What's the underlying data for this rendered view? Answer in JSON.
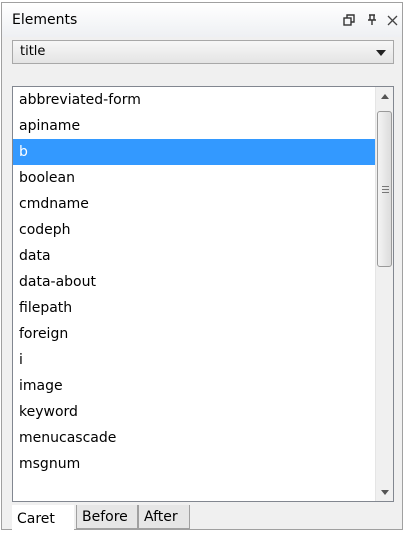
{
  "panel": {
    "title": "Elements",
    "icons": [
      "restore-icon",
      "pin-icon",
      "close-icon"
    ]
  },
  "combo": {
    "value": "title"
  },
  "list": {
    "selected_index": 2,
    "items": [
      "abbreviated-form",
      "apiname",
      "b",
      "boolean",
      "cmdname",
      "codeph",
      "data",
      "data-about",
      "filepath",
      "foreign",
      "i",
      "image",
      "keyword",
      "menucascade",
      "msgnum"
    ]
  },
  "tabs": [
    {
      "label": "Caret",
      "active": true
    },
    {
      "label": "Before",
      "active": false
    },
    {
      "label": "After",
      "active": false
    }
  ],
  "colors": {
    "selection": "#3399ff",
    "panel_bg": "#f0f0f0"
  }
}
